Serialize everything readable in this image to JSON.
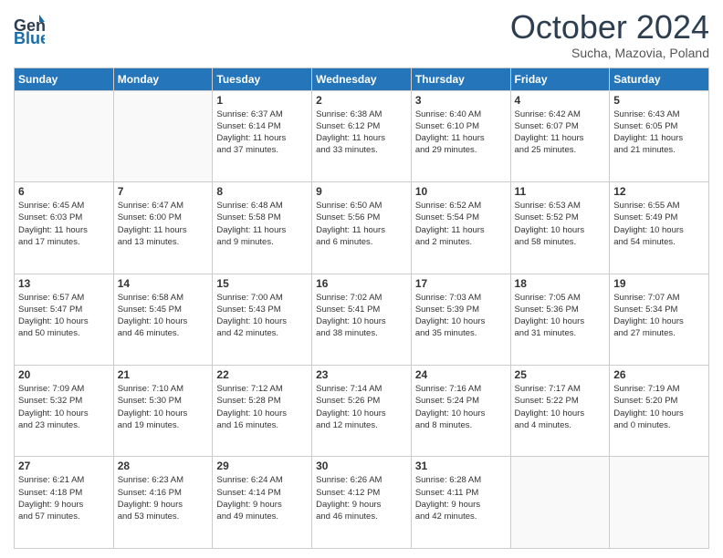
{
  "header": {
    "logo_line1": "General",
    "logo_line2": "Blue",
    "month": "October 2024",
    "location": "Sucha, Mazovia, Poland"
  },
  "days_of_week": [
    "Sunday",
    "Monday",
    "Tuesday",
    "Wednesday",
    "Thursday",
    "Friday",
    "Saturday"
  ],
  "weeks": [
    [
      {
        "day": "",
        "info": ""
      },
      {
        "day": "",
        "info": ""
      },
      {
        "day": "1",
        "info": "Sunrise: 6:37 AM\nSunset: 6:14 PM\nDaylight: 11 hours\nand 37 minutes."
      },
      {
        "day": "2",
        "info": "Sunrise: 6:38 AM\nSunset: 6:12 PM\nDaylight: 11 hours\nand 33 minutes."
      },
      {
        "day": "3",
        "info": "Sunrise: 6:40 AM\nSunset: 6:10 PM\nDaylight: 11 hours\nand 29 minutes."
      },
      {
        "day": "4",
        "info": "Sunrise: 6:42 AM\nSunset: 6:07 PM\nDaylight: 11 hours\nand 25 minutes."
      },
      {
        "day": "5",
        "info": "Sunrise: 6:43 AM\nSunset: 6:05 PM\nDaylight: 11 hours\nand 21 minutes."
      }
    ],
    [
      {
        "day": "6",
        "info": "Sunrise: 6:45 AM\nSunset: 6:03 PM\nDaylight: 11 hours\nand 17 minutes."
      },
      {
        "day": "7",
        "info": "Sunrise: 6:47 AM\nSunset: 6:00 PM\nDaylight: 11 hours\nand 13 minutes."
      },
      {
        "day": "8",
        "info": "Sunrise: 6:48 AM\nSunset: 5:58 PM\nDaylight: 11 hours\nand 9 minutes."
      },
      {
        "day": "9",
        "info": "Sunrise: 6:50 AM\nSunset: 5:56 PM\nDaylight: 11 hours\nand 6 minutes."
      },
      {
        "day": "10",
        "info": "Sunrise: 6:52 AM\nSunset: 5:54 PM\nDaylight: 11 hours\nand 2 minutes."
      },
      {
        "day": "11",
        "info": "Sunrise: 6:53 AM\nSunset: 5:52 PM\nDaylight: 10 hours\nand 58 minutes."
      },
      {
        "day": "12",
        "info": "Sunrise: 6:55 AM\nSunset: 5:49 PM\nDaylight: 10 hours\nand 54 minutes."
      }
    ],
    [
      {
        "day": "13",
        "info": "Sunrise: 6:57 AM\nSunset: 5:47 PM\nDaylight: 10 hours\nand 50 minutes."
      },
      {
        "day": "14",
        "info": "Sunrise: 6:58 AM\nSunset: 5:45 PM\nDaylight: 10 hours\nand 46 minutes."
      },
      {
        "day": "15",
        "info": "Sunrise: 7:00 AM\nSunset: 5:43 PM\nDaylight: 10 hours\nand 42 minutes."
      },
      {
        "day": "16",
        "info": "Sunrise: 7:02 AM\nSunset: 5:41 PM\nDaylight: 10 hours\nand 38 minutes."
      },
      {
        "day": "17",
        "info": "Sunrise: 7:03 AM\nSunset: 5:39 PM\nDaylight: 10 hours\nand 35 minutes."
      },
      {
        "day": "18",
        "info": "Sunrise: 7:05 AM\nSunset: 5:36 PM\nDaylight: 10 hours\nand 31 minutes."
      },
      {
        "day": "19",
        "info": "Sunrise: 7:07 AM\nSunset: 5:34 PM\nDaylight: 10 hours\nand 27 minutes."
      }
    ],
    [
      {
        "day": "20",
        "info": "Sunrise: 7:09 AM\nSunset: 5:32 PM\nDaylight: 10 hours\nand 23 minutes."
      },
      {
        "day": "21",
        "info": "Sunrise: 7:10 AM\nSunset: 5:30 PM\nDaylight: 10 hours\nand 19 minutes."
      },
      {
        "day": "22",
        "info": "Sunrise: 7:12 AM\nSunset: 5:28 PM\nDaylight: 10 hours\nand 16 minutes."
      },
      {
        "day": "23",
        "info": "Sunrise: 7:14 AM\nSunset: 5:26 PM\nDaylight: 10 hours\nand 12 minutes."
      },
      {
        "day": "24",
        "info": "Sunrise: 7:16 AM\nSunset: 5:24 PM\nDaylight: 10 hours\nand 8 minutes."
      },
      {
        "day": "25",
        "info": "Sunrise: 7:17 AM\nSunset: 5:22 PM\nDaylight: 10 hours\nand 4 minutes."
      },
      {
        "day": "26",
        "info": "Sunrise: 7:19 AM\nSunset: 5:20 PM\nDaylight: 10 hours\nand 0 minutes."
      }
    ],
    [
      {
        "day": "27",
        "info": "Sunrise: 6:21 AM\nSunset: 4:18 PM\nDaylight: 9 hours\nand 57 minutes."
      },
      {
        "day": "28",
        "info": "Sunrise: 6:23 AM\nSunset: 4:16 PM\nDaylight: 9 hours\nand 53 minutes."
      },
      {
        "day": "29",
        "info": "Sunrise: 6:24 AM\nSunset: 4:14 PM\nDaylight: 9 hours\nand 49 minutes."
      },
      {
        "day": "30",
        "info": "Sunrise: 6:26 AM\nSunset: 4:12 PM\nDaylight: 9 hours\nand 46 minutes."
      },
      {
        "day": "31",
        "info": "Sunrise: 6:28 AM\nSunset: 4:11 PM\nDaylight: 9 hours\nand 42 minutes."
      },
      {
        "day": "",
        "info": ""
      },
      {
        "day": "",
        "info": ""
      }
    ]
  ]
}
